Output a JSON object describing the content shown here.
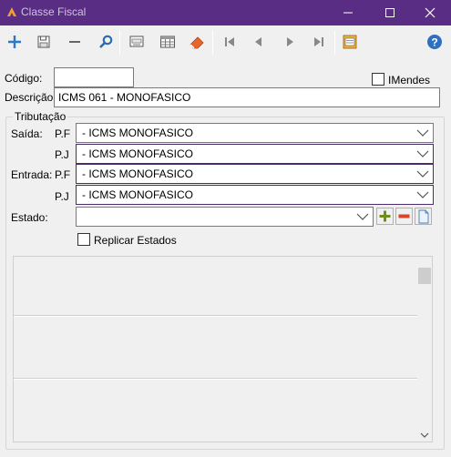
{
  "window": {
    "title": "Classe Fiscal",
    "titlebar_color": "#5a2d85"
  },
  "toolbar": {
    "icons": [
      "add-icon",
      "save-icon",
      "remove-icon",
      "search-icon",
      "print-icon",
      "table-icon",
      "eraser-icon",
      "first-icon",
      "previous-icon",
      "next-icon",
      "last-icon",
      "export-icon",
      "help-icon"
    ]
  },
  "form": {
    "codigo_label": "Código:",
    "codigo_value": "",
    "imendes_label": "IMendes",
    "descricao_label": "Descrição:",
    "descricao_value": "ICMS 061 - MONOFASICO"
  },
  "tributacao": {
    "title": "Tributação",
    "saida_label": "Saída:",
    "entrada_label": "Entrada:",
    "pf_label": "P.F",
    "pj_label": "P.J",
    "saida_pf": "- ICMS MONOFASICO",
    "saida_pj": "- ICMS MONOFASICO",
    "entrada_pf": "- ICMS MONOFASICO",
    "entrada_pj": "- ICMS MONOFASICO",
    "estado_label": "Estado:",
    "estado_value": "",
    "replicar_label": "Replicar Estados"
  }
}
